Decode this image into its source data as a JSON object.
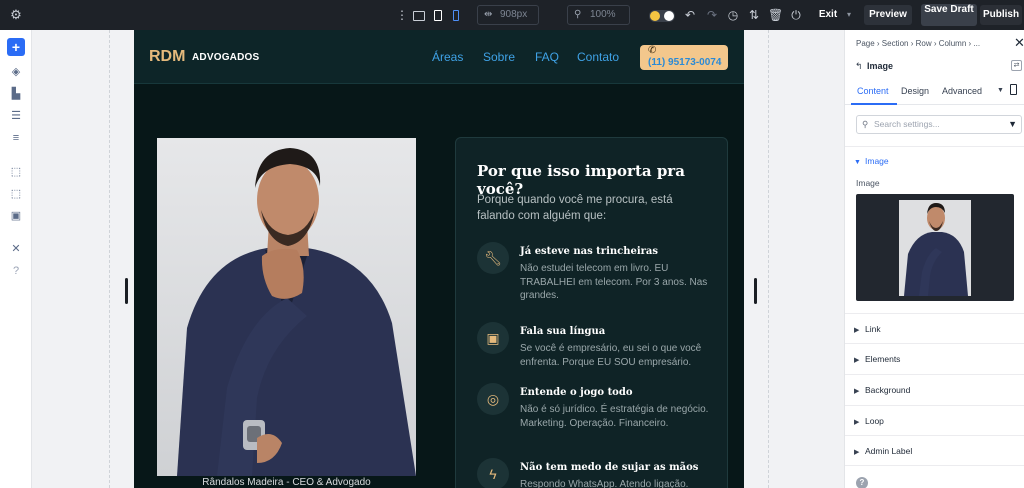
{
  "toolbar": {
    "width_value": "908px",
    "zoom_value": "100%",
    "exit_label": "Exit",
    "preview_label": "Preview",
    "save_draft_label": "Save Draft",
    "publish_label": "Publish",
    "accent_color": "#2b6cf5"
  },
  "site": {
    "logo_main": "RDM",
    "logo_sub": "ADVOGADOS",
    "nav": [
      "Áreas",
      "Sobre",
      "FAQ",
      "Contato"
    ],
    "phone_icon": "phone-icon",
    "phone_number": "(11) 95173-0074",
    "photo_caption": "Rândalos Madeira - CEO & Advogado",
    "card": {
      "title": "Por que isso importa pra você?",
      "intro": "Porque quando você me procura, está falando com alguém que:",
      "features": [
        {
          "icon": "wrench-icon",
          "title": "Já esteve nas trincheiras",
          "desc": "Não estudei telecom em livro. EU TRABALHEI em telecom. Por 3 anos. Nas grandes."
        },
        {
          "icon": "briefcase-icon",
          "title": "Fala sua língua",
          "desc": "Se você é empresário, eu sei o que você enfrenta. Porque EU SOU empresário."
        },
        {
          "icon": "target-icon",
          "title": "Entende o jogo todo",
          "desc": "Não é só jurídico. É estratégia de negócio. Marketing. Operação. Financeiro."
        },
        {
          "icon": "lightning-icon",
          "title": "Não tem medo de sujar as mãos",
          "desc": "Respondo WhatsApp. Atendo ligação."
        }
      ]
    }
  },
  "panel": {
    "breadcrumb": "Page › Section › Row › Column › ...",
    "element_title": "Image",
    "tabs": [
      "Content",
      "Design",
      "Advanced"
    ],
    "search_placeholder": "Search settings...",
    "image_section": "Image",
    "image_field_label": "Image",
    "sections": [
      "Link",
      "Elements",
      "Background",
      "Loop",
      "Admin Label"
    ],
    "help_label": "?"
  }
}
